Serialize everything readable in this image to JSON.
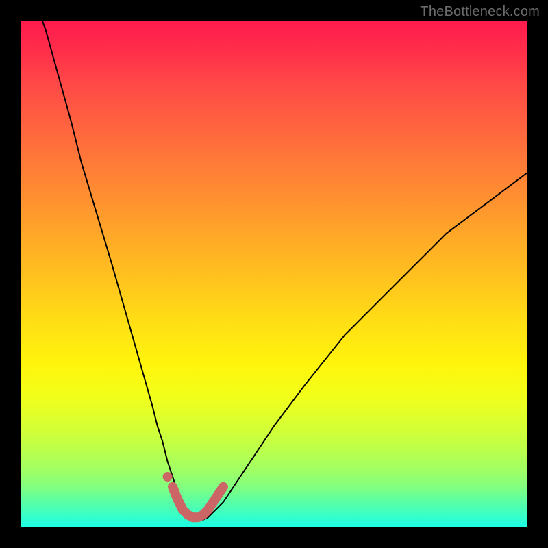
{
  "watermark": "TheBottleneck.com",
  "chart_data": {
    "type": "line",
    "title": "",
    "xlabel": "",
    "ylabel": "",
    "xlim": [
      0,
      100
    ],
    "ylim": [
      0,
      100
    ],
    "x": [
      0,
      5,
      10,
      12,
      15,
      18,
      20,
      22,
      24,
      26,
      27,
      28,
      29,
      30,
      31,
      32,
      33,
      34,
      35,
      36,
      37,
      38,
      40,
      42,
      44,
      46,
      48,
      50,
      53,
      56,
      60,
      64,
      68,
      72,
      76,
      80,
      84,
      88,
      92,
      96,
      100
    ],
    "values": [
      112,
      98,
      80,
      72,
      62,
      52,
      45,
      38,
      31,
      24,
      20,
      17,
      13,
      10,
      7,
      5,
      3,
      2,
      1.5,
      1.5,
      2,
      3,
      5,
      8,
      11,
      14,
      17,
      20,
      24,
      28,
      33,
      38,
      42,
      46,
      50,
      54,
      58,
      61,
      64,
      67,
      70
    ],
    "marker": {
      "dot": {
        "x": 29,
        "y": 10
      },
      "path_x": [
        30,
        31,
        32,
        33,
        34,
        35,
        36,
        37,
        38,
        40
      ],
      "path_y": [
        8,
        5.5,
        3.5,
        2.5,
        2,
        2,
        2.5,
        3.5,
        5,
        8
      ],
      "note": "Salmon-colored highlight near the valley of the curve"
    },
    "background_gradient": {
      "orientation": "vertical",
      "stops": [
        {
          "pos": 0.0,
          "color": "#ff1a4d"
        },
        {
          "pos": 0.5,
          "color": "#ffd020"
        },
        {
          "pos": 0.75,
          "color": "#eeff20"
        },
        {
          "pos": 1.0,
          "color": "#1affe6"
        }
      ],
      "meaning": "High values red/hot at top, low values green/teal at bottom"
    }
  }
}
